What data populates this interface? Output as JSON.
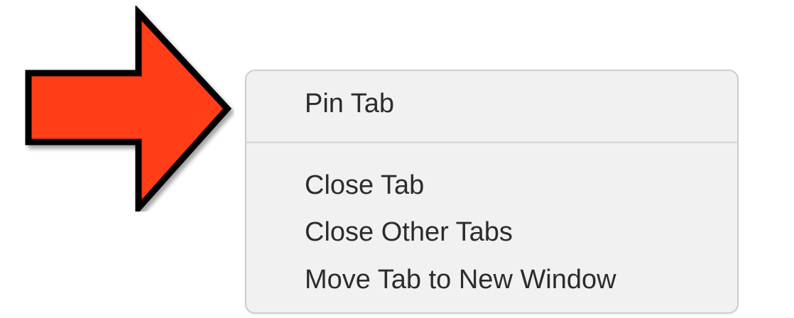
{
  "callout": {
    "icon": "right-arrow-icon",
    "fill_color": "#ff3d12",
    "outline_color": "#000000"
  },
  "context_menu": {
    "background_color": "#f2f1f1",
    "items": [
      {
        "label": "Pin Tab"
      },
      {
        "label": "Close Tab"
      },
      {
        "label": "Close Other Tabs"
      },
      {
        "label": "Move Tab to New Window"
      }
    ]
  }
}
